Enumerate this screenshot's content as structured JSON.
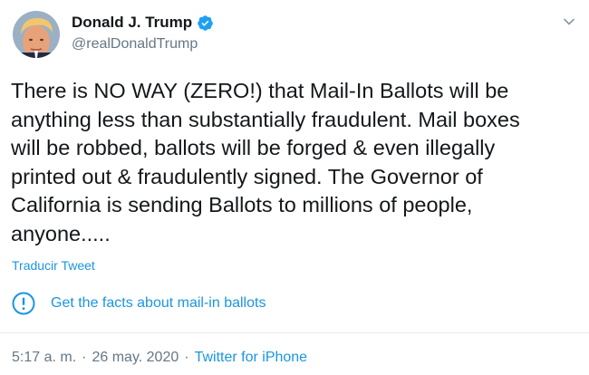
{
  "author": {
    "display_name": "Donald J. Trump",
    "handle": "@realDonaldTrump",
    "verified": true
  },
  "tweet": {
    "text": "There is NO WAY (ZERO!) that Mail-In Ballots will be\nanything less than substantially fraudulent. Mail boxes\nwill be robbed, ballots will be forged & even illegally\nprinted out & fraudulently signed. The Governor of\nCalifornia is sending Ballots to millions of people,\nanyone.....",
    "translate_label": "Traducir Tweet"
  },
  "fact_check": {
    "label": "Get the facts about mail-in ballots",
    "icon": "exclamation-circle-icon"
  },
  "meta": {
    "time": "5:17 a. m.",
    "date": "26 may. 2020",
    "source": "Twitter for iPhone",
    "separator": "·"
  },
  "colors": {
    "link": "#1b95e0",
    "secondary_text": "#657786",
    "verified": "#1da1f2",
    "divider": "#e6ecf0"
  }
}
